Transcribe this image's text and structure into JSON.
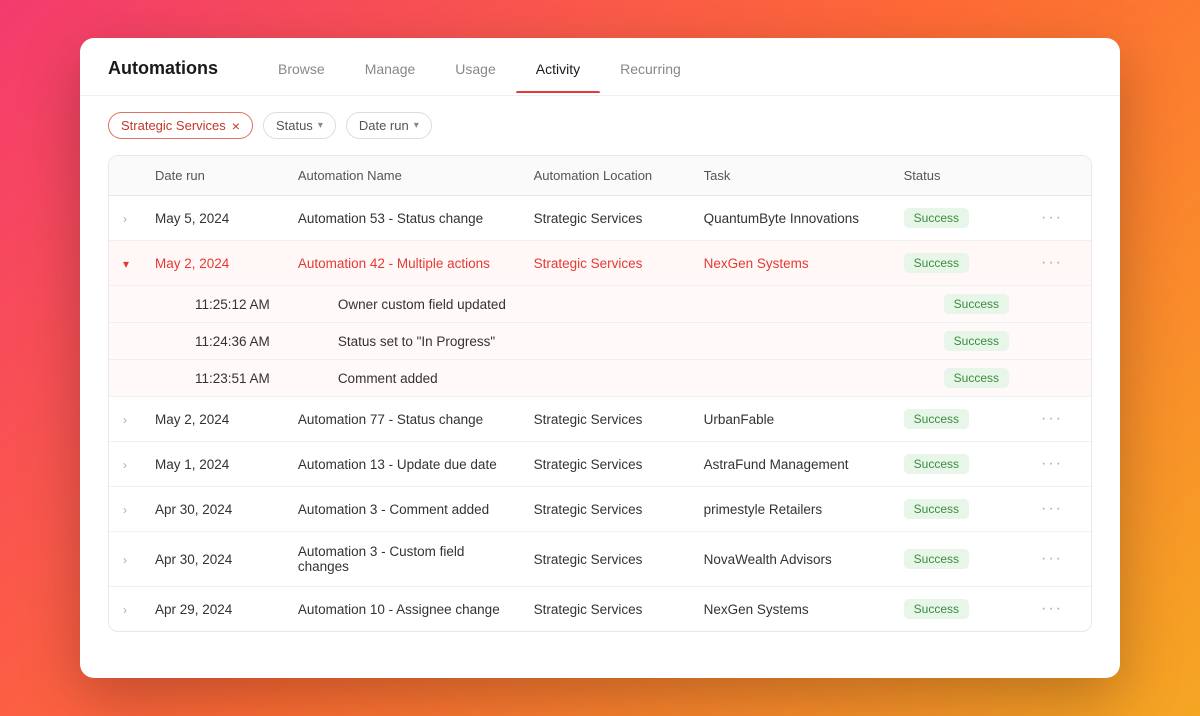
{
  "window": {
    "title": "Automations"
  },
  "tabs": [
    {
      "id": "browse",
      "label": "Browse",
      "active": false
    },
    {
      "id": "manage",
      "label": "Manage",
      "active": false
    },
    {
      "id": "usage",
      "label": "Usage",
      "active": false
    },
    {
      "id": "activity",
      "label": "Activity",
      "active": true
    },
    {
      "id": "recurring",
      "label": "Recurring",
      "active": false
    }
  ],
  "filters": {
    "tag": "Strategic Services",
    "status_label": "Status",
    "daterun_label": "Date run"
  },
  "table": {
    "headers": [
      "",
      "Date run",
      "Automation Name",
      "Automation Location",
      "Task",
      "Status",
      ""
    ],
    "rows": [
      {
        "id": "row1",
        "expanded": false,
        "date": "May 5, 2024",
        "name": "Automation 53 - Status change",
        "location": "Strategic Services",
        "task": "QuantumByte Innovations",
        "status": "Success",
        "subrows": []
      },
      {
        "id": "row2",
        "expanded": true,
        "date": "May 2, 2024",
        "name": "Automation 42 - Multiple actions",
        "location": "Strategic Services",
        "task": "NexGen Systems",
        "status": "Success",
        "subrows": [
          {
            "time": "11:25:12 AM",
            "action": "Owner custom field updated",
            "status": "Success"
          },
          {
            "time": "11:24:36 AM",
            "action": "Status set to \"In Progress\"",
            "status": "Success"
          },
          {
            "time": "11:23:51 AM",
            "action": "Comment added",
            "status": "Success"
          }
        ]
      },
      {
        "id": "row3",
        "expanded": false,
        "date": "May 2, 2024",
        "name": "Automation 77 - Status change",
        "location": "Strategic Services",
        "task": "UrbanFable",
        "status": "Success",
        "subrows": []
      },
      {
        "id": "row4",
        "expanded": false,
        "date": "May 1, 2024",
        "name": "Automation 13 - Update due date",
        "location": "Strategic Services",
        "task": "AstraFund Management",
        "status": "Success",
        "subrows": []
      },
      {
        "id": "row5",
        "expanded": false,
        "date": "Apr 30, 2024",
        "name": "Automation 3 - Comment added",
        "location": "Strategic Services",
        "task": "primestyle Retailers",
        "status": "Success",
        "subrows": []
      },
      {
        "id": "row6",
        "expanded": false,
        "date": "Apr 30, 2024",
        "name": "Automation 3 - Custom field changes",
        "location": "Strategic Services",
        "task": "NovaWealth Advisors",
        "status": "Success",
        "subrows": []
      },
      {
        "id": "row7",
        "expanded": false,
        "date": "Apr 29, 2024",
        "name": "Automation 10 - Assignee change",
        "location": "Strategic Services",
        "task": "NexGen Systems",
        "status": "Success",
        "subrows": []
      }
    ]
  }
}
